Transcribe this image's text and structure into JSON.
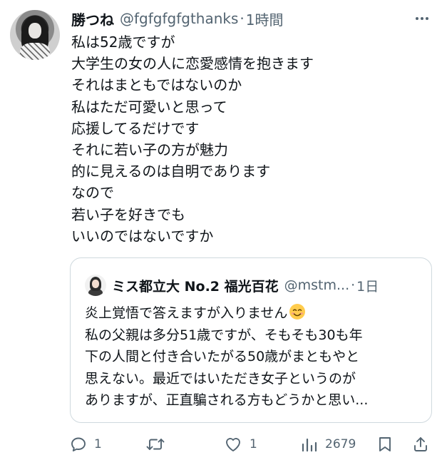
{
  "tweet": {
    "author_name": "勝つね",
    "author_handle": "@fgfgfgfgthanks",
    "separator": "·",
    "time": "1時間",
    "more_icon": "more-horizontal-icon",
    "lines": [
      "私は52歳ですが",
      "大学生の女の人に恋愛感情を抱きます",
      "それはまともではないのか",
      "私はただ可愛いと思って",
      "応援してるだけです",
      "それに若い子の方が魅力",
      "的に見えるのは自明であります",
      "なので",
      "若い子を好きでも",
      "いいのではないですか"
    ]
  },
  "quote": {
    "author_name": "ミス都立大 No.2 福光百花",
    "author_handle": "@mstm...",
    "separator": "·",
    "time": "1日",
    "lines": [
      "炎上覚悟で答えますが入りません",
      "私の父親は多分51歳ですが、そもそも30も年",
      "下の人間と付き合いたがる50歳がまともやと",
      "思えない。最近ではいただき女子というのが",
      "ありますが、正直騙される方もどうかと思い..."
    ],
    "emoji": "smiling-face-emoji"
  },
  "actions": {
    "reply_count": "1",
    "retweet_count": "",
    "like_count": "1",
    "views_count": "2679",
    "icons": [
      "reply-icon",
      "retweet-icon",
      "like-icon",
      "views-icon",
      "bookmark-icon",
      "share-icon"
    ],
    "icon_color": "#536471"
  },
  "colors": {
    "text_primary": "#0f1419",
    "text_secondary": "#536471",
    "border": "#cfd9de",
    "background": "#ffffff"
  }
}
